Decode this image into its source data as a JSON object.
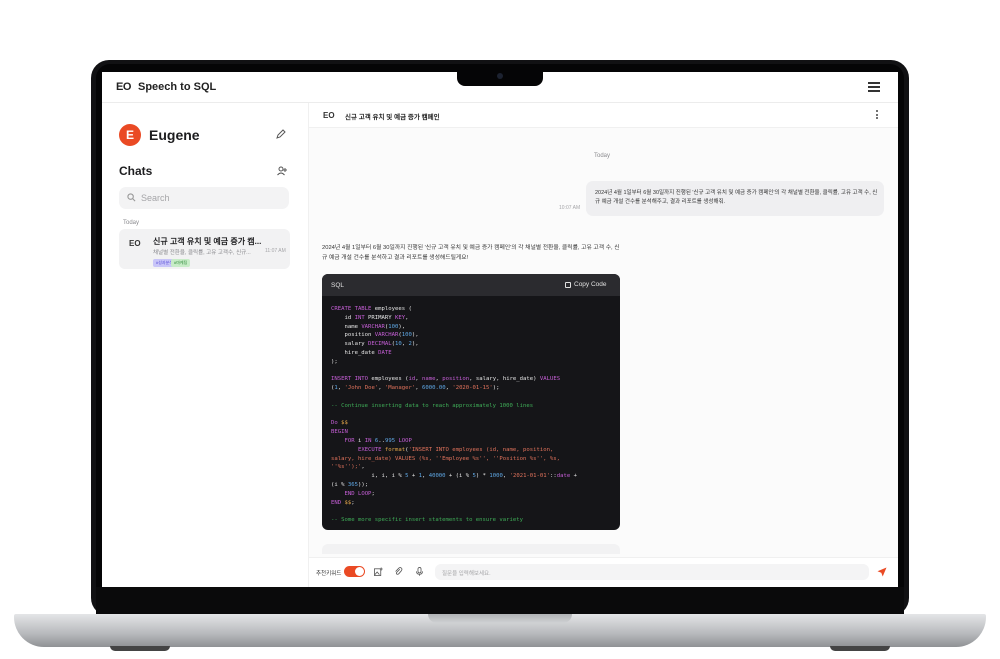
{
  "app": {
    "logo": "EO",
    "title": "Speech to SQL"
  },
  "sidebar": {
    "user_initial": "E",
    "user_name": "Eugene",
    "chats_heading": "Chats",
    "search_placeholder": "Search",
    "section_today": "Today",
    "chat_items": [
      {
        "logo": "EO",
        "title": "신규 고객 유치 및 예금 증가 캠...",
        "subtitle": "채널별 전환율, 클릭률, 고유 고객수, 신규...",
        "time": "11:07 AM",
        "tags": [
          "#성과분석",
          "#마케팅"
        ]
      }
    ]
  },
  "chat": {
    "header_logo": "EO",
    "header_title": "신규 고객 유치 및 예금 증가 캠페인",
    "date_label": "Today",
    "user_message": "2024년 4월 1일부터 6월 30일까지 진행된 '신규 고객 유치 및 예금 증가 캠페인'의 각 채널별 전환율, 클릭률, 고유 고객 수, 신규 예금 개설 건수를 분석해주고, 결과 리포트를 생성해줘.",
    "user_time": "10:07 AM",
    "ai_message": "2024년 4월 1일부터 6월 30일까지 진행된 '신규 고객 유치 및 예금 증가 캠페인'의 각 채널별 전환율, 클릭률, 고유 고객 수, 신규 예금 개설 건수를 분석하고 결과 리포트를 생성해드릴게요!",
    "code_language": "SQL",
    "copy_label": "Copy Code",
    "composer": {
      "keyword_label": "추천키워드",
      "input_placeholder": "질문을 입력해보세요."
    }
  },
  "colors": {
    "accent": "#ea4a24",
    "code_bg": "#151518",
    "keyword": "#c75fd8",
    "string": "#e2735c",
    "number": "#5fa8e6",
    "comment": "#3fae58"
  }
}
